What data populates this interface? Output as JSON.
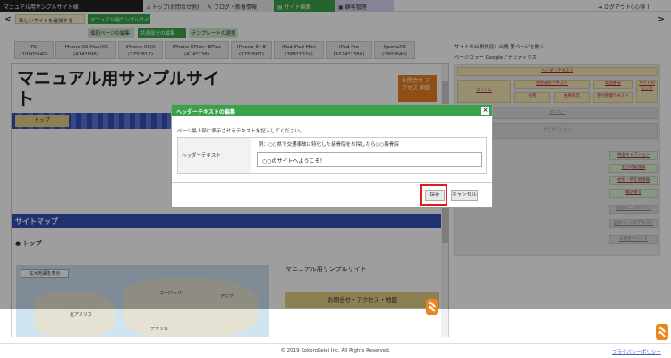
{
  "topbar": {
    "site_name": "マニュアル用サンプルサイト様",
    "nav_home": "トップ(お問合せ他)",
    "nav_blog": "ブログ・新着情報",
    "nav_site": "サイト編集",
    "nav_mgmt": "顧客管理",
    "logout": "ログアウト( 心得 )"
  },
  "subbar": {
    "add_site": "新しいサイトを追加する",
    "current_site": "マニュアル用サンプルサイト",
    "tabs": [
      "個別ページの編集",
      "共通部分の編集",
      "テンプレートの選択"
    ]
  },
  "devices": [
    {
      "name": "PC",
      "res": "(1000*640)"
    },
    {
      "name": "iPhone XS Max/XR",
      "res": "(414*896)"
    },
    {
      "name": "iPhone XS/X",
      "res": "(375*812)"
    },
    {
      "name": "iPhone 6Plus~8Plus",
      "res": "(414*736)"
    },
    {
      "name": "iPhone 6~8",
      "res": "(375*667)"
    },
    {
      "name": "iPad/iPad Mini",
      "res": "(768*1024)"
    },
    {
      "name": "iPad Pro",
      "res": "(1024*1366)"
    },
    {
      "name": "XperiaXZ",
      "res": "(360*640)"
    }
  ],
  "editor": {
    "site_title": "マニュアル用サンプルサイト",
    "contact_badge": "お問合せ アクセス 地図",
    "nav_top": "トップ",
    "sitemap_heading": "サイトマップ",
    "sitemap_top": "トップ",
    "map_zoom": "拡大地図を表示",
    "map_labels": [
      "ヨーロッパ",
      "アジア",
      "北アメリカ",
      "アフリカ"
    ],
    "sitemap_site": "マニュアル用サンプルサイト",
    "sitemap_contact": "お問合せ・アクセス・地図"
  },
  "right_panel": {
    "status": "サイトの公開状況：公開  第ページを開く",
    "colors": "ページカラー  Googleアナリティクス",
    "cells": [
      "ヘッダーテキスト",
      "タイトル",
      "住所表示テキスト",
      "電話番号",
      "サイト内リンク",
      "住所",
      "住所表示",
      "受付時間テキスト",
      "メニュー",
      "ナビゲーション",
      "共通キャプション",
      "受付時間登録",
      "住所・所在地情報",
      "電話番号",
      "追加ページのリスト",
      "追加ページのテキスト",
      "お問合せリンク"
    ]
  },
  "modal": {
    "title": "ヘッダーテキストの編集",
    "close": "×",
    "description": "ページ最上部に表示させるテキストを記入してください。",
    "row_label": "ヘッダーテキスト",
    "example": "例：○○県で交通事故に特化した接骨院をお探しなら○○接骨院",
    "field_value": "○○のサイトへようこそ！",
    "save": "保存",
    "cancel": "キャンセル"
  },
  "footer": {
    "copyright": "© 2019 KokoroKeiei Inc. All Rights Reserved.",
    "privacy": "プライバシーポリシー"
  },
  "colors": {
    "accent_green": "#3aa34a",
    "nav_blue": "#3450b8",
    "highlight_red": "#e01a1a",
    "badge_orange": "#e67e22"
  }
}
